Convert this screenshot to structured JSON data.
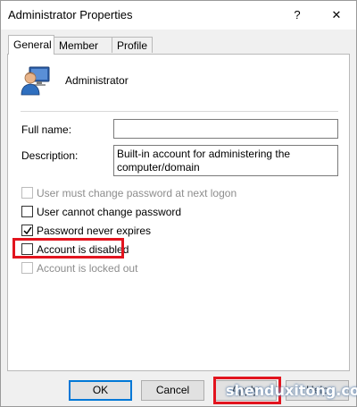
{
  "window": {
    "title": "Administrator Properties",
    "help_label": "?",
    "close_label": "✕"
  },
  "tabs": [
    {
      "label": "General",
      "active": true
    },
    {
      "label": "Member Of",
      "active": false
    },
    {
      "label": "Profile",
      "active": false
    }
  ],
  "general": {
    "username": "Administrator",
    "avatar_icon": "user-account-icon",
    "full_name_label": "Full name:",
    "full_name_value": "",
    "description_label": "Description:",
    "description_line1": "Built-in account for administering the",
    "description_line2": "computer/domain"
  },
  "checkboxes": [
    {
      "label": "User must change password at next logon",
      "checked": false,
      "disabled": true
    },
    {
      "label": "User cannot change password",
      "checked": false,
      "disabled": false
    },
    {
      "label": "Password never expires",
      "checked": true,
      "disabled": false
    },
    {
      "label": "Account is disabled",
      "checked": false,
      "disabled": false
    },
    {
      "label": "Account is locked out",
      "checked": false,
      "disabled": true
    }
  ],
  "buttons": {
    "ok": "OK",
    "cancel": "Cancel",
    "apply": "Apply",
    "help": "Help"
  },
  "watermark": "shenduxitong.com",
  "colors": {
    "highlight": "#e2141e",
    "accent": "#0078d7"
  }
}
